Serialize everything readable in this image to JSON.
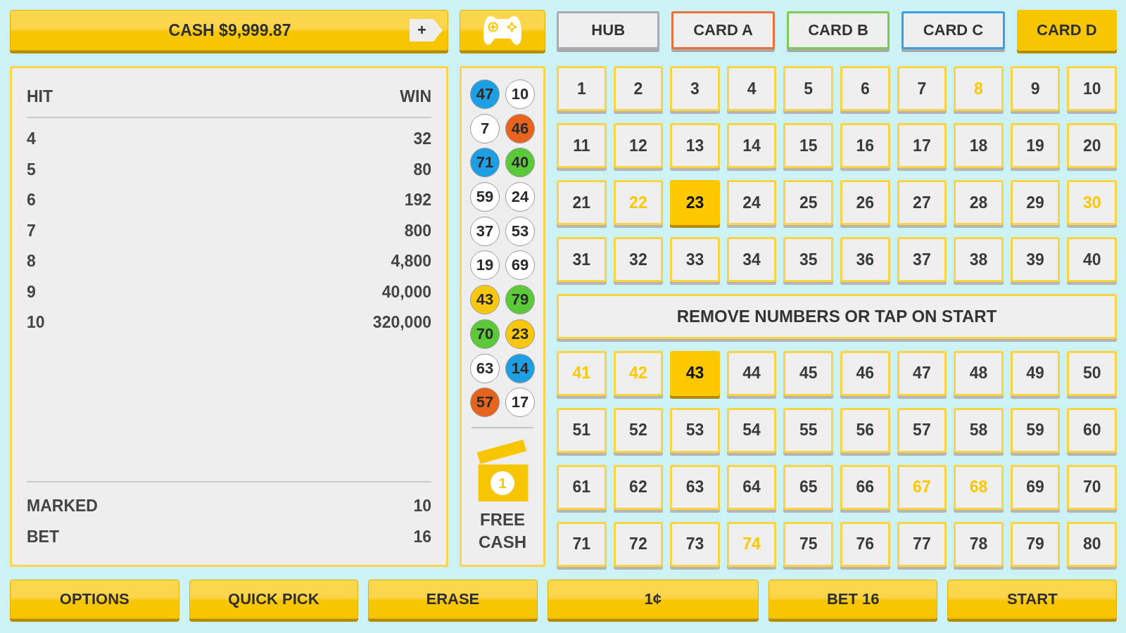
{
  "cash_bar": {
    "label": "CASH $9,999.87",
    "add_button": "+"
  },
  "tabs": [
    {
      "label": "HUB",
      "color": "#a9adb2",
      "selected": false
    },
    {
      "label": "CARD A",
      "color": "#e8703a",
      "selected": false
    },
    {
      "label": "CARD B",
      "color": "#7dcb55",
      "selected": false
    },
    {
      "label": "CARD C",
      "color": "#3aa0e0",
      "selected": false
    },
    {
      "label": "CARD D",
      "color": "#f8c600",
      "selected": true
    }
  ],
  "paytable": {
    "columns": [
      "HIT",
      "WIN"
    ],
    "rows": [
      {
        "hit": "4",
        "win": "32"
      },
      {
        "hit": "5",
        "win": "80"
      },
      {
        "hit": "6",
        "win": "192"
      },
      {
        "hit": "7",
        "win": "800"
      },
      {
        "hit": "8",
        "win": "4,800"
      },
      {
        "hit": "9",
        "win": "40,000"
      },
      {
        "hit": "10",
        "win": "320,000"
      }
    ],
    "summary": [
      {
        "label": "MARKED",
        "value": "10"
      },
      {
        "label": "BET",
        "value": "16"
      }
    ]
  },
  "drawn_balls": [
    {
      "number": "47",
      "color": "#1e9ee3"
    },
    {
      "number": "10",
      "color": "#ffffff"
    },
    {
      "number": "7",
      "color": "#ffffff"
    },
    {
      "number": "46",
      "color": "#e8641e"
    },
    {
      "number": "71",
      "color": "#1e9ee3"
    },
    {
      "number": "40",
      "color": "#5cc93a"
    },
    {
      "number": "59",
      "color": "#ffffff"
    },
    {
      "number": "24",
      "color": "#ffffff"
    },
    {
      "number": "37",
      "color": "#ffffff"
    },
    {
      "number": "53",
      "color": "#ffffff"
    },
    {
      "number": "19",
      "color": "#ffffff"
    },
    {
      "number": "69",
      "color": "#ffffff"
    },
    {
      "number": "43",
      "color": "#f9c80e"
    },
    {
      "number": "79",
      "color": "#5cc93a"
    },
    {
      "number": "70",
      "color": "#5cc93a"
    },
    {
      "number": "23",
      "color": "#f9c80e"
    },
    {
      "number": "63",
      "color": "#ffffff"
    },
    {
      "number": "14",
      "color": "#1e9ee3"
    },
    {
      "number": "57",
      "color": "#e8641e"
    },
    {
      "number": "17",
      "color": "#ffffff"
    }
  ],
  "free_cash": {
    "badge": "1",
    "label": "FREE CASH"
  },
  "number_grid": {
    "upper": [
      {
        "label": "1",
        "selected": false,
        "hit": false
      },
      {
        "label": "2",
        "selected": false,
        "hit": false
      },
      {
        "label": "3",
        "selected": false,
        "hit": false
      },
      {
        "label": "4",
        "selected": false,
        "hit": false
      },
      {
        "label": "5",
        "selected": false,
        "hit": false
      },
      {
        "label": "6",
        "selected": false,
        "hit": false
      },
      {
        "label": "7",
        "selected": false,
        "hit": false
      },
      {
        "label": "8",
        "selected": true,
        "hit": false
      },
      {
        "label": "9",
        "selected": false,
        "hit": false
      },
      {
        "label": "10",
        "selected": false,
        "hit": false
      },
      {
        "label": "11",
        "selected": false,
        "hit": false
      },
      {
        "label": "12",
        "selected": false,
        "hit": false
      },
      {
        "label": "13",
        "selected": false,
        "hit": false
      },
      {
        "label": "14",
        "selected": false,
        "hit": false
      },
      {
        "label": "15",
        "selected": false,
        "hit": false
      },
      {
        "label": "16",
        "selected": false,
        "hit": false
      },
      {
        "label": "17",
        "selected": false,
        "hit": false
      },
      {
        "label": "18",
        "selected": false,
        "hit": false
      },
      {
        "label": "19",
        "selected": false,
        "hit": false
      },
      {
        "label": "20",
        "selected": false,
        "hit": false
      },
      {
        "label": "21",
        "selected": false,
        "hit": false
      },
      {
        "label": "22",
        "selected": true,
        "hit": false
      },
      {
        "label": "23",
        "selected": true,
        "hit": true
      },
      {
        "label": "24",
        "selected": false,
        "hit": false
      },
      {
        "label": "25",
        "selected": false,
        "hit": false
      },
      {
        "label": "26",
        "selected": false,
        "hit": false
      },
      {
        "label": "27",
        "selected": false,
        "hit": false
      },
      {
        "label": "28",
        "selected": false,
        "hit": false
      },
      {
        "label": "29",
        "selected": false,
        "hit": false
      },
      {
        "label": "30",
        "selected": true,
        "hit": false
      },
      {
        "label": "31",
        "selected": false,
        "hit": false
      },
      {
        "label": "32",
        "selected": false,
        "hit": false
      },
      {
        "label": "33",
        "selected": false,
        "hit": false
      },
      {
        "label": "34",
        "selected": false,
        "hit": false
      },
      {
        "label": "35",
        "selected": false,
        "hit": false
      },
      {
        "label": "36",
        "selected": false,
        "hit": false
      },
      {
        "label": "37",
        "selected": false,
        "hit": false
      },
      {
        "label": "38",
        "selected": false,
        "hit": false
      },
      {
        "label": "39",
        "selected": false,
        "hit": false
      },
      {
        "label": "40",
        "selected": false,
        "hit": false
      }
    ],
    "message": "REMOVE NUMBERS OR TAP ON START",
    "lower": [
      {
        "label": "41",
        "selected": true,
        "hit": false
      },
      {
        "label": "42",
        "selected": true,
        "hit": false
      },
      {
        "label": "43",
        "selected": true,
        "hit": true
      },
      {
        "label": "44",
        "selected": false,
        "hit": false
      },
      {
        "label": "45",
        "selected": false,
        "hit": false
      },
      {
        "label": "46",
        "selected": false,
        "hit": false
      },
      {
        "label": "47",
        "selected": false,
        "hit": false
      },
      {
        "label": "48",
        "selected": false,
        "hit": false
      },
      {
        "label": "49",
        "selected": false,
        "hit": false
      },
      {
        "label": "50",
        "selected": false,
        "hit": false
      },
      {
        "label": "51",
        "selected": false,
        "hit": false
      },
      {
        "label": "52",
        "selected": false,
        "hit": false
      },
      {
        "label": "53",
        "selected": false,
        "hit": false
      },
      {
        "label": "54",
        "selected": false,
        "hit": false
      },
      {
        "label": "55",
        "selected": false,
        "hit": false
      },
      {
        "label": "56",
        "selected": false,
        "hit": false
      },
      {
        "label": "57",
        "selected": false,
        "hit": false
      },
      {
        "label": "58",
        "selected": false,
        "hit": false
      },
      {
        "label": "59",
        "selected": false,
        "hit": false
      },
      {
        "label": "60",
        "selected": false,
        "hit": false
      },
      {
        "label": "61",
        "selected": false,
        "hit": false
      },
      {
        "label": "62",
        "selected": false,
        "hit": false
      },
      {
        "label": "63",
        "selected": false,
        "hit": false
      },
      {
        "label": "64",
        "selected": false,
        "hit": false
      },
      {
        "label": "65",
        "selected": false,
        "hit": false
      },
      {
        "label": "66",
        "selected": false,
        "hit": false
      },
      {
        "label": "67",
        "selected": true,
        "hit": false
      },
      {
        "label": "68",
        "selected": true,
        "hit": false
      },
      {
        "label": "69",
        "selected": false,
        "hit": false
      },
      {
        "label": "70",
        "selected": false,
        "hit": false
      },
      {
        "label": "71",
        "selected": false,
        "hit": false
      },
      {
        "label": "72",
        "selected": false,
        "hit": false
      },
      {
        "label": "73",
        "selected": false,
        "hit": false
      },
      {
        "label": "74",
        "selected": true,
        "hit": false
      },
      {
        "label": "75",
        "selected": false,
        "hit": false
      },
      {
        "label": "76",
        "selected": false,
        "hit": false
      },
      {
        "label": "77",
        "selected": false,
        "hit": false
      },
      {
        "label": "78",
        "selected": false,
        "hit": false
      },
      {
        "label": "79",
        "selected": false,
        "hit": false
      },
      {
        "label": "80",
        "selected": false,
        "hit": false
      }
    ]
  },
  "buttons": [
    {
      "label": "OPTIONS",
      "kind": "action"
    },
    {
      "label": "QUICK PICK",
      "kind": "action"
    },
    {
      "label": "ERASE",
      "kind": "action"
    },
    {
      "label": "1¢",
      "kind": "denomination"
    },
    {
      "label": "BET 16",
      "kind": "action"
    },
    {
      "label": "START",
      "kind": "action"
    }
  ]
}
